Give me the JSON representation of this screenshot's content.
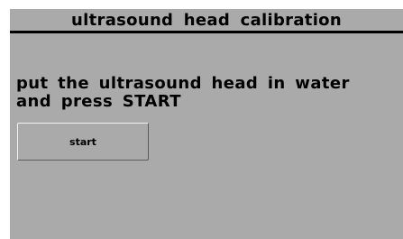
{
  "screen": {
    "title": "ultrasound head calibration",
    "instruction": "put the ultrasound head in water and press START",
    "start_button_label": "start"
  },
  "colors": {
    "background": "#aaaaaa",
    "text": "#000000",
    "button_highlight": "#f2f2f2",
    "button_shadow": "#5c5c5c"
  }
}
